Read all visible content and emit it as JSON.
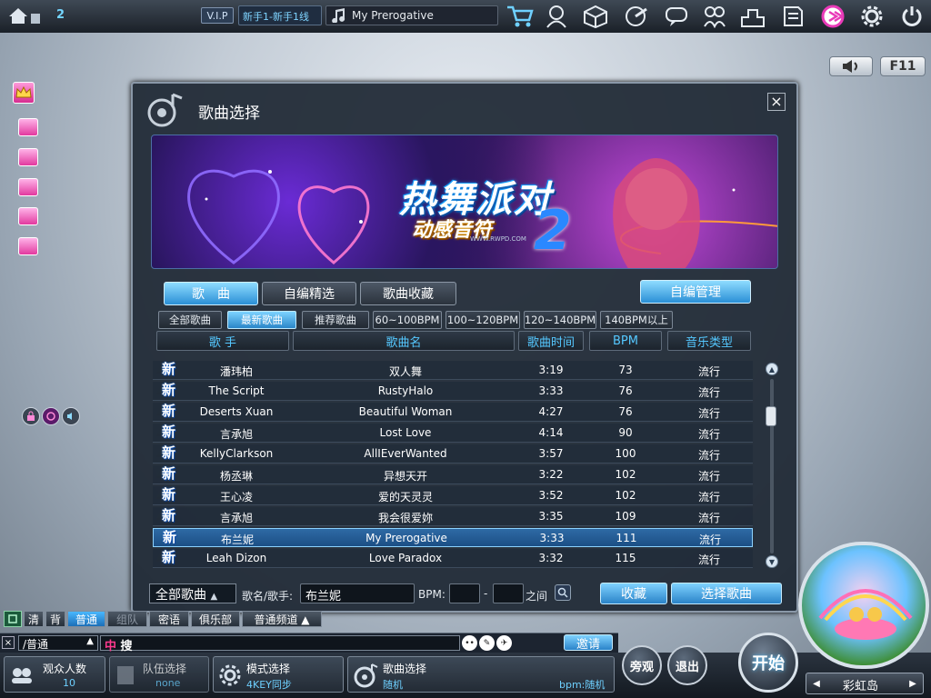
{
  "topbar": {
    "player_count": "2",
    "vip_label": "V.I.P",
    "server_label": "新手1-新手1线",
    "current_song": "My Prerogative",
    "icons": [
      "home-icon",
      "shop-cart-icon",
      "character-icon",
      "package-icon",
      "music-note-icon",
      "chat-bubble-icon",
      "friends-icon",
      "ranking-icon",
      "notes-icon",
      "event-icon",
      "settings-icon",
      "power-icon"
    ]
  },
  "side_buttons": {
    "volume_label": "",
    "f11_label": "F11"
  },
  "dialog": {
    "title": "歌曲选择",
    "close_label": "×",
    "banner_logo": "热舞派对",
    "banner_sub": "动感音符",
    "banner_url": "WWW.RWPD.COM",
    "main_tabs": [
      {
        "label": "歌　曲",
        "active": true
      },
      {
        "label": "自编精选",
        "active": false
      },
      {
        "label": "歌曲收藏",
        "active": false
      }
    ],
    "custom_manage_label": "自编管理",
    "filter_tabs": [
      {
        "label": "全部歌曲",
        "active": false
      },
      {
        "label": "最新歌曲",
        "active": true
      },
      {
        "label": "推荐歌曲",
        "active": false
      },
      {
        "label": "60~100BPM",
        "active": false
      },
      {
        "label": "100~120BPM",
        "active": false
      },
      {
        "label": "120~140BPM",
        "active": false
      },
      {
        "label": "140BPM以上",
        "active": false
      }
    ],
    "columns": [
      "歌 手",
      "歌曲名",
      "歌曲时间",
      "BPM",
      "音乐类型"
    ],
    "new_tag": "新",
    "songs": [
      {
        "artist": "潘玮柏",
        "title": "双人舞",
        "time": "3:19",
        "bpm": "73",
        "genre": "流行",
        "selected": false
      },
      {
        "artist": "The Script",
        "title": "RustyHalo",
        "time": "3:33",
        "bpm": "76",
        "genre": "流行",
        "selected": false
      },
      {
        "artist": "Deserts Xuan",
        "title": "Beautiful Woman",
        "time": "4:27",
        "bpm": "76",
        "genre": "流行",
        "selected": false
      },
      {
        "artist": "言承旭",
        "title": "Lost Love",
        "time": "4:14",
        "bpm": "90",
        "genre": "流行",
        "selected": false
      },
      {
        "artist": "KellyClarkson",
        "title": "AllIEverWanted",
        "time": "3:57",
        "bpm": "100",
        "genre": "流行",
        "selected": false
      },
      {
        "artist": "杨丞琳",
        "title": "异想天开",
        "time": "3:22",
        "bpm": "102",
        "genre": "流行",
        "selected": false
      },
      {
        "artist": "王心凌",
        "title": "爱的天灵灵",
        "time": "3:52",
        "bpm": "102",
        "genre": "流行",
        "selected": false
      },
      {
        "artist": "言承旭",
        "title": "我会很爱妳",
        "time": "3:35",
        "bpm": "109",
        "genre": "流行",
        "selected": false
      },
      {
        "artist": "布兰妮",
        "title": "My Prerogative",
        "time": "3:33",
        "bpm": "111",
        "genre": "流行",
        "selected": true
      },
      {
        "artist": "Leah Dizon",
        "title": "Love Paradox",
        "time": "3:32",
        "bpm": "115",
        "genre": "流行",
        "selected": false
      }
    ],
    "filter": {
      "category_value": "全部歌曲",
      "name_label": "歌名/歌手:",
      "name_value": "布兰妮",
      "bpm_label": "BPM:",
      "bpm_min": "",
      "bpm_dash": "-",
      "bpm_max": "",
      "between_label": "之间"
    },
    "favorite_button": "收藏",
    "select_button": "选择歌曲"
  },
  "chat": {
    "tabs": [
      "清",
      "背",
      "普通",
      "组队",
      "密语",
      "俱乐部",
      "普通频道 ▲"
    ],
    "channel_value": "/普通",
    "search_tag": "中",
    "search_label": "搜",
    "invite_label": "邀请"
  },
  "bottom": {
    "audience_label": "观众人数",
    "audience_value": "10",
    "team_label": "队伍选择",
    "team_value": "none",
    "mode_label": "模式选择",
    "mode_value": "4KEY同步",
    "song_label": "歌曲选择",
    "song_value": "随机",
    "song_bpm": "bpm:随机",
    "watch_label": "旁观",
    "exit_label": "退出",
    "start_label": "开始",
    "map_label": "彩虹岛"
  }
}
